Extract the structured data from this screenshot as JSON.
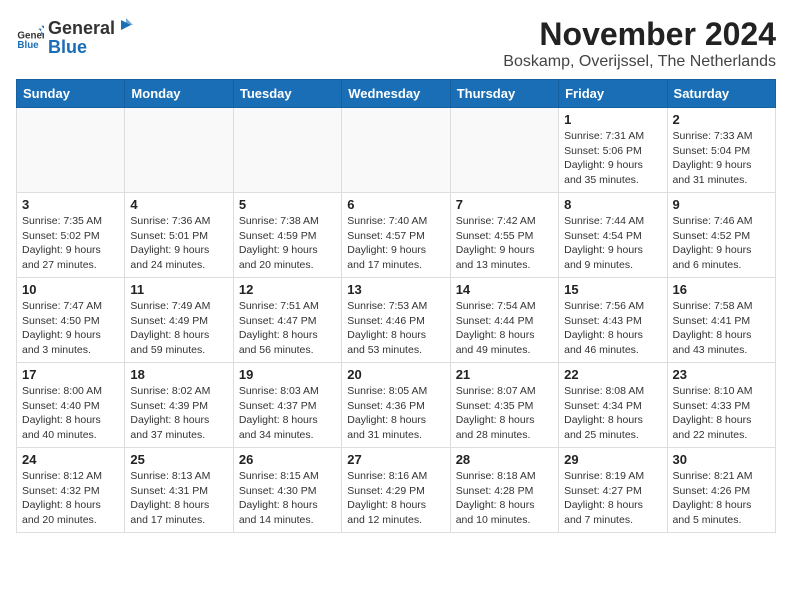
{
  "header": {
    "logo_general": "General",
    "logo_blue": "Blue",
    "month_title": "November 2024",
    "location": "Boskamp, Overijssel, The Netherlands"
  },
  "days_of_week": [
    "Sunday",
    "Monday",
    "Tuesday",
    "Wednesday",
    "Thursday",
    "Friday",
    "Saturday"
  ],
  "weeks": [
    [
      {
        "day": "",
        "info": ""
      },
      {
        "day": "",
        "info": ""
      },
      {
        "day": "",
        "info": ""
      },
      {
        "day": "",
        "info": ""
      },
      {
        "day": "",
        "info": ""
      },
      {
        "day": "1",
        "info": "Sunrise: 7:31 AM\nSunset: 5:06 PM\nDaylight: 9 hours and 35 minutes."
      },
      {
        "day": "2",
        "info": "Sunrise: 7:33 AM\nSunset: 5:04 PM\nDaylight: 9 hours and 31 minutes."
      }
    ],
    [
      {
        "day": "3",
        "info": "Sunrise: 7:35 AM\nSunset: 5:02 PM\nDaylight: 9 hours and 27 minutes."
      },
      {
        "day": "4",
        "info": "Sunrise: 7:36 AM\nSunset: 5:01 PM\nDaylight: 9 hours and 24 minutes."
      },
      {
        "day": "5",
        "info": "Sunrise: 7:38 AM\nSunset: 4:59 PM\nDaylight: 9 hours and 20 minutes."
      },
      {
        "day": "6",
        "info": "Sunrise: 7:40 AM\nSunset: 4:57 PM\nDaylight: 9 hours and 17 minutes."
      },
      {
        "day": "7",
        "info": "Sunrise: 7:42 AM\nSunset: 4:55 PM\nDaylight: 9 hours and 13 minutes."
      },
      {
        "day": "8",
        "info": "Sunrise: 7:44 AM\nSunset: 4:54 PM\nDaylight: 9 hours and 9 minutes."
      },
      {
        "day": "9",
        "info": "Sunrise: 7:46 AM\nSunset: 4:52 PM\nDaylight: 9 hours and 6 minutes."
      }
    ],
    [
      {
        "day": "10",
        "info": "Sunrise: 7:47 AM\nSunset: 4:50 PM\nDaylight: 9 hours and 3 minutes."
      },
      {
        "day": "11",
        "info": "Sunrise: 7:49 AM\nSunset: 4:49 PM\nDaylight: 8 hours and 59 minutes."
      },
      {
        "day": "12",
        "info": "Sunrise: 7:51 AM\nSunset: 4:47 PM\nDaylight: 8 hours and 56 minutes."
      },
      {
        "day": "13",
        "info": "Sunrise: 7:53 AM\nSunset: 4:46 PM\nDaylight: 8 hours and 53 minutes."
      },
      {
        "day": "14",
        "info": "Sunrise: 7:54 AM\nSunset: 4:44 PM\nDaylight: 8 hours and 49 minutes."
      },
      {
        "day": "15",
        "info": "Sunrise: 7:56 AM\nSunset: 4:43 PM\nDaylight: 8 hours and 46 minutes."
      },
      {
        "day": "16",
        "info": "Sunrise: 7:58 AM\nSunset: 4:41 PM\nDaylight: 8 hours and 43 minutes."
      }
    ],
    [
      {
        "day": "17",
        "info": "Sunrise: 8:00 AM\nSunset: 4:40 PM\nDaylight: 8 hours and 40 minutes."
      },
      {
        "day": "18",
        "info": "Sunrise: 8:02 AM\nSunset: 4:39 PM\nDaylight: 8 hours and 37 minutes."
      },
      {
        "day": "19",
        "info": "Sunrise: 8:03 AM\nSunset: 4:37 PM\nDaylight: 8 hours and 34 minutes."
      },
      {
        "day": "20",
        "info": "Sunrise: 8:05 AM\nSunset: 4:36 PM\nDaylight: 8 hours and 31 minutes."
      },
      {
        "day": "21",
        "info": "Sunrise: 8:07 AM\nSunset: 4:35 PM\nDaylight: 8 hours and 28 minutes."
      },
      {
        "day": "22",
        "info": "Sunrise: 8:08 AM\nSunset: 4:34 PM\nDaylight: 8 hours and 25 minutes."
      },
      {
        "day": "23",
        "info": "Sunrise: 8:10 AM\nSunset: 4:33 PM\nDaylight: 8 hours and 22 minutes."
      }
    ],
    [
      {
        "day": "24",
        "info": "Sunrise: 8:12 AM\nSunset: 4:32 PM\nDaylight: 8 hours and 20 minutes."
      },
      {
        "day": "25",
        "info": "Sunrise: 8:13 AM\nSunset: 4:31 PM\nDaylight: 8 hours and 17 minutes."
      },
      {
        "day": "26",
        "info": "Sunrise: 8:15 AM\nSunset: 4:30 PM\nDaylight: 8 hours and 14 minutes."
      },
      {
        "day": "27",
        "info": "Sunrise: 8:16 AM\nSunset: 4:29 PM\nDaylight: 8 hours and 12 minutes."
      },
      {
        "day": "28",
        "info": "Sunrise: 8:18 AM\nSunset: 4:28 PM\nDaylight: 8 hours and 10 minutes."
      },
      {
        "day": "29",
        "info": "Sunrise: 8:19 AM\nSunset: 4:27 PM\nDaylight: 8 hours and 7 minutes."
      },
      {
        "day": "30",
        "info": "Sunrise: 8:21 AM\nSunset: 4:26 PM\nDaylight: 8 hours and 5 minutes."
      }
    ]
  ]
}
